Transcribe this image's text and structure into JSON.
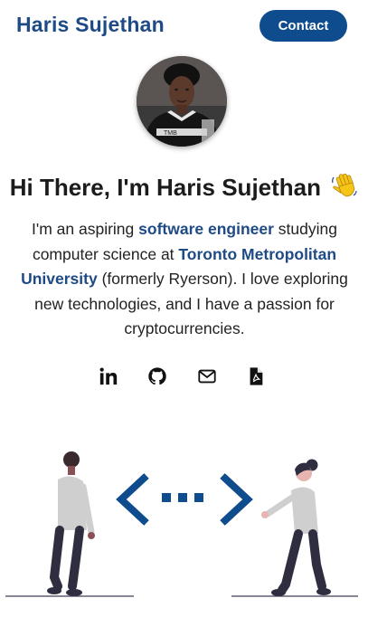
{
  "header": {
    "brand": "Haris Sujethan",
    "contact_label": "Contact"
  },
  "hero": {
    "greeting": "Hi There, I'm Haris Sujethan",
    "wave_emoji": "waving-hand",
    "bio": {
      "part1": "I'm an aspiring ",
      "highlight1": "software engineer",
      "part2": " studying computer science at ",
      "highlight2": "Toronto Metropolitan University",
      "part3": " (formerly Ryerson). I love exploring new technologies, and I have a passion for cryptocurrencies."
    }
  },
  "socials": [
    {
      "icon": "linkedin-icon"
    },
    {
      "icon": "github-icon"
    },
    {
      "icon": "mail-icon"
    },
    {
      "icon": "pdf-resume-icon"
    }
  ],
  "colors": {
    "accent": "#1e4a86",
    "button": "#0e4c8e",
    "text": "#222222"
  }
}
